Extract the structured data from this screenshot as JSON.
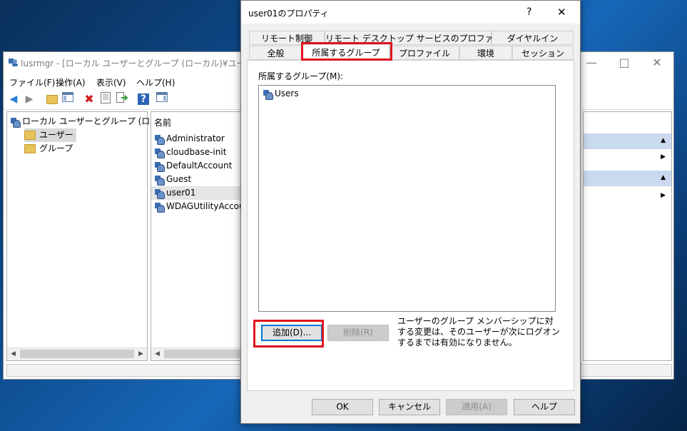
{
  "lusrmgr": {
    "title": "lusrmgr - [ローカル ユーザーとグループ (ローカル)¥ユーザー]",
    "menu": [
      "ファイル(F)",
      "操作(A)",
      "表示(V)",
      "ヘルプ(H)"
    ],
    "tree": {
      "root": "ローカル ユーザーとグループ (ローカル)",
      "children": [
        "ユーザー",
        "グループ"
      ],
      "selected": "ユーザー"
    },
    "list": {
      "column": "名前",
      "users": [
        "Administrator",
        "cloudbase-init",
        "DefaultAccount",
        "Guest",
        "user01",
        "WDAGUtilityAccoun"
      ],
      "selected": "user01"
    },
    "icons": {
      "back": "back-arrow-icon",
      "forward": "forward-arrow-icon",
      "up": "up-folder-icon",
      "show_hide": "console-tree-icon",
      "delete": "delete-x-icon",
      "properties": "properties-icon",
      "export": "export-list-icon",
      "help": "help-icon",
      "extra": "action-pane-icon"
    }
  },
  "dialog": {
    "title": "user01のプロパティ",
    "help_glyph": "?",
    "close_glyph": "✕",
    "tabs_row1": [
      "リモート制御",
      "リモート デスクトップ サービスのプロファイル",
      "ダイヤルイン"
    ],
    "tabs_row2": [
      "全般",
      "所属するグループ",
      "プロファイル",
      "環境",
      "セッション"
    ],
    "active_tab": "所属するグループ",
    "member_label": "所属するグループ(M):",
    "members": [
      "Users"
    ],
    "add_button": "追加(D)...",
    "remove_button": "削除(R)",
    "note": "ユーザーのグループ メンバーシップに対する変更は、そのユーザーが次にログオンするまでは有効になりません。",
    "ok_button": "OK",
    "cancel_button": "キャンセル",
    "apply_button": "適用(A)",
    "help_button": "ヘルプ"
  },
  "colors": {
    "highlight": "#e0141e",
    "selection": "#d9d9d9",
    "accent": "#0078d7"
  }
}
